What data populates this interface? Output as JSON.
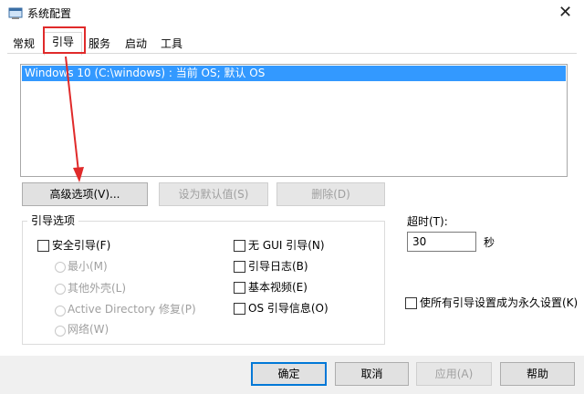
{
  "window": {
    "title": "系统配置",
    "close_glyph": "✕"
  },
  "tabs": [
    {
      "label": "常规"
    },
    {
      "label": "引导"
    },
    {
      "label": "服务"
    },
    {
      "label": "启动"
    },
    {
      "label": "工具"
    }
  ],
  "os_list": {
    "entries": [
      "Windows 10 (C:\\windows) : 当前 OS; 默认 OS"
    ]
  },
  "list_buttons": {
    "advanced": "高级选项(V)...",
    "set_default": "设为默认值(S)",
    "delete": "删除(D)"
  },
  "boot_options": {
    "group_label": "引导选项",
    "safe_boot": "安全引导(F)",
    "minimal": "最小(M)",
    "alternate_shell": "其他外壳(L)",
    "ad_repair": "Active Directory 修复(P)",
    "network": "网络(W)",
    "no_gui": "无 GUI 引导(N)",
    "boot_log": "引导日志(B)",
    "base_video": "基本视频(E)",
    "os_boot_info": "OS 引导信息(O)"
  },
  "timeout": {
    "label": "超时(T):",
    "value": "30",
    "unit": "秒"
  },
  "permanent": {
    "label": "使所有引导设置成为永久设置(K)"
  },
  "footer": {
    "ok": "确定",
    "cancel": "取消",
    "apply": "应用(A)",
    "help": "帮助"
  },
  "colors": {
    "selection": "#3399ff",
    "annotation": "#e02a2a",
    "default_button_border": "#0078d7"
  },
  "icons": [
    "msconfig-app-icon",
    "close-icon"
  ]
}
